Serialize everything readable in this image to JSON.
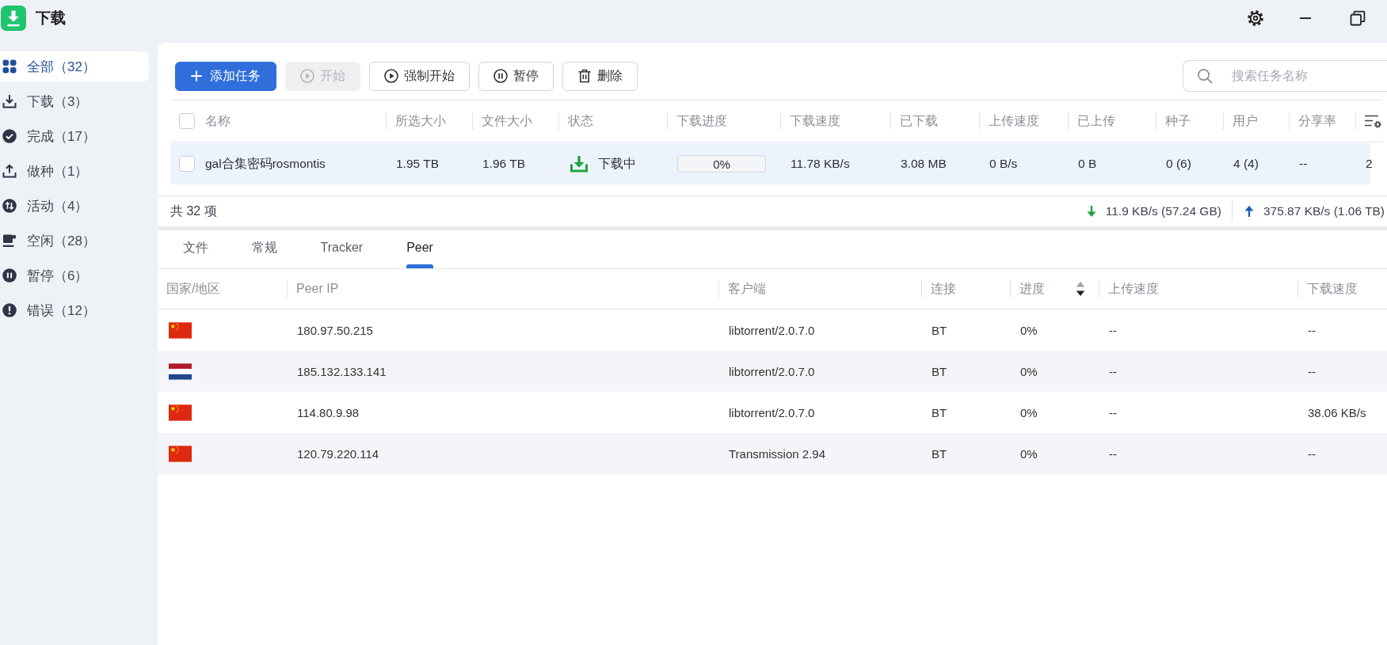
{
  "window": {
    "title": "下载"
  },
  "sidebar": {
    "items": [
      {
        "label": "全部（32）",
        "kind": "all",
        "selected": true
      },
      {
        "label": "下载（3）",
        "kind": "downloading",
        "selected": false
      },
      {
        "label": "完成（17）",
        "kind": "completed",
        "selected": false
      },
      {
        "label": "做种（1）",
        "kind": "seeding",
        "selected": false
      },
      {
        "label": "活动（4）",
        "kind": "active",
        "selected": false
      },
      {
        "label": "空闲（28）",
        "kind": "idle",
        "selected": false
      },
      {
        "label": "暂停（6）",
        "kind": "paused",
        "selected": false
      },
      {
        "label": "错误（12）",
        "kind": "error",
        "selected": false
      }
    ]
  },
  "toolbar": {
    "buttons": [
      {
        "label": "添加任务",
        "kind": "add",
        "primary": true,
        "disabled": false
      },
      {
        "label": "开始",
        "kind": "start",
        "primary": false,
        "disabled": true
      },
      {
        "label": "强制开始",
        "kind": "start",
        "primary": false,
        "disabled": false
      },
      {
        "label": "暂停",
        "kind": "pause",
        "primary": false,
        "disabled": false
      },
      {
        "label": "删除",
        "kind": "delete",
        "primary": false,
        "disabled": false
      }
    ],
    "search": {
      "placeholder": "搜索任务名称"
    }
  },
  "task_table": {
    "all_checked": false,
    "columns": [
      "名称",
      "所选大小",
      "文件大小",
      "状态",
      "下载进度",
      "下载速度",
      "已下载",
      "上传速度",
      "已上传",
      "种子",
      "用户",
      "分享率"
    ],
    "rows": [
      {
        "checked": false,
        "selected": true,
        "cells": [
          {
            "kind": "text",
            "text": "gal合集密码rosmontis"
          },
          {
            "kind": "text",
            "text": "1.95 TB"
          },
          {
            "kind": "text",
            "text": "1.96 TB"
          },
          {
            "kind": "downloading",
            "text": "下载中"
          },
          {
            "kind": "progress",
            "level": 0,
            "text": "0%"
          },
          {
            "kind": "text",
            "text": "11.78 KB/s"
          },
          {
            "kind": "text",
            "text": "3.08 MB"
          },
          {
            "kind": "text",
            "text": "0 B/s"
          },
          {
            "kind": "text",
            "text": "0 B"
          },
          {
            "kind": "text",
            "text": "0 (6)"
          },
          {
            "kind": "text",
            "text": "4 (4)"
          },
          {
            "kind": "text",
            "text": "--"
          },
          {
            "kind": "text",
            "text": "2"
          }
        ]
      }
    ]
  },
  "status_bar": {
    "summary": "共 32 项",
    "download_total": "11.9 KB/s (57.24 GB)",
    "upload_total": "375.87 KB/s (1.06 TB)"
  },
  "detail_tabs": [
    {
      "label": "文件",
      "selected": false
    },
    {
      "label": "常规",
      "selected": false
    },
    {
      "label": "Tracker",
      "selected": false
    },
    {
      "label": "Peer",
      "selected": true
    }
  ],
  "peer_table": {
    "columns": [
      {
        "label": "国家/地区",
        "sortable": false
      },
      {
        "label": "Peer IP",
        "sortable": false
      },
      {
        "label": "客户端",
        "sortable": false
      },
      {
        "label": "连接",
        "sortable": false
      },
      {
        "label": "进度",
        "sortable": true,
        "descending": true
      },
      {
        "label": "上传速度",
        "sortable": false
      },
      {
        "label": "下载速度",
        "sortable": false
      }
    ],
    "rows": [
      {
        "kind": "china",
        "ip": "180.97.50.215",
        "client": "libtorrent/2.0.7.0",
        "connection": "BT",
        "progress": "0%",
        "upload_speed": "--",
        "download_speed": "--"
      },
      {
        "kind": "netherlands",
        "ip": "185.132.133.141",
        "client": "libtorrent/2.0.7.0",
        "connection": "BT",
        "progress": "0%",
        "upload_speed": "--",
        "download_speed": "--"
      },
      {
        "kind": "china",
        "ip": "114.80.9.98",
        "client": "libtorrent/2.0.7.0",
        "connection": "BT",
        "progress": "0%",
        "upload_speed": "--",
        "download_speed": "38.06 KB/s"
      },
      {
        "kind": "china",
        "ip": "120.79.220.114",
        "client": "Transmission 2.94",
        "connection": "BT",
        "progress": "0%",
        "upload_speed": "--",
        "download_speed": "--"
      }
    ]
  }
}
